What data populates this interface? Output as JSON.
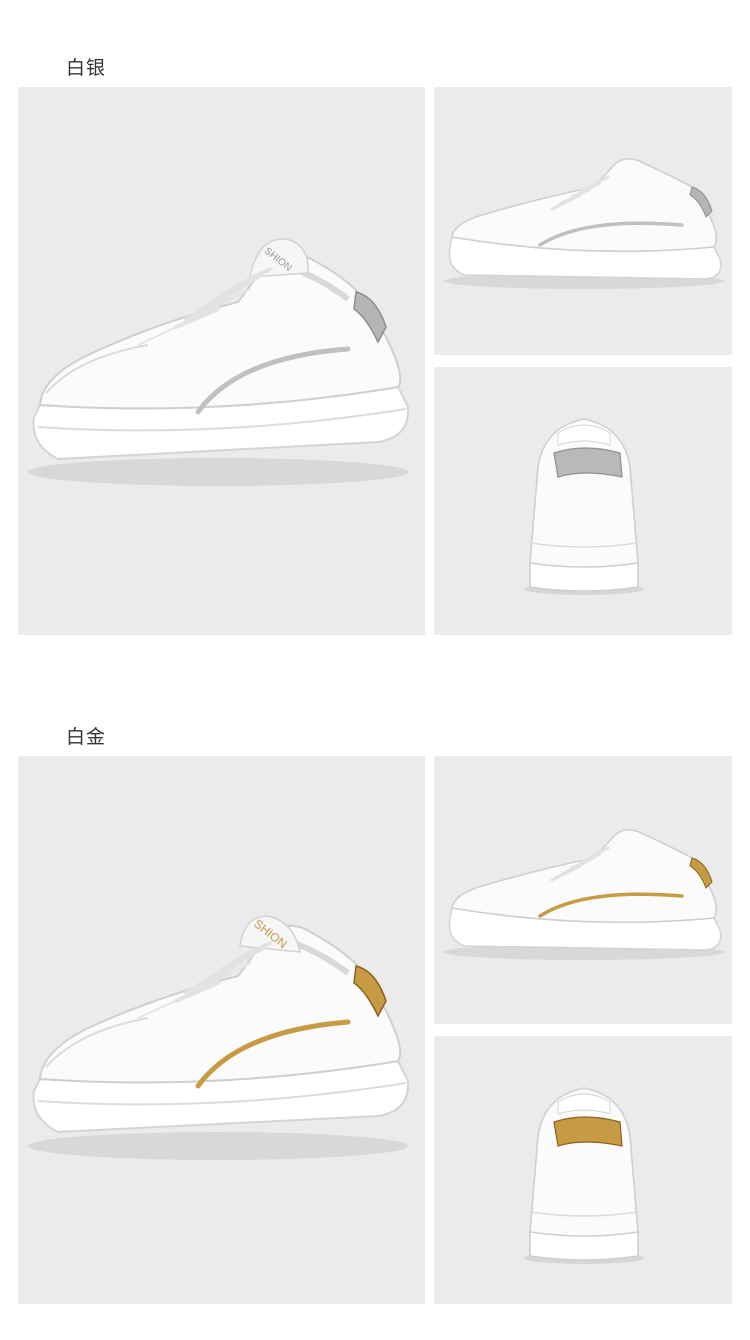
{
  "sections": [
    {
      "label": "白银",
      "accent": "#c0c0c0",
      "accent_dark": "#8e8e8e",
      "tongue_text": "SHION",
      "views": [
        "side-view",
        "side-view-small",
        "rear-view"
      ]
    },
    {
      "label": "白金",
      "accent": "#c79a44",
      "accent_dark": "#8a6120",
      "tongue_text": "SHION",
      "views": [
        "side-view",
        "side-view-small",
        "rear-view"
      ]
    }
  ],
  "colors": {
    "background": "#ffffff",
    "panel": "#ebebeb",
    "shoe": "#fbfbfb"
  }
}
